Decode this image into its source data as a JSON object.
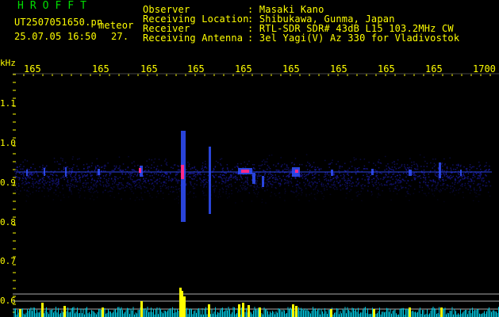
{
  "header": {
    "brand": "HROFFT",
    "filename": "UT2507051650.pn",
    "mode": "meteor",
    "datetime": "25.07.05 16:50",
    "count": "27.",
    "labels": [
      "Observer",
      "Receiving Location",
      "Receiver",
      "Receiving Antenna"
    ],
    "values": [
      ": Masaki Kano",
      ": Shibukawa, Gunma, Japan",
      ": RTL-SDR SDR# 43dB L15 103.2MHz CW",
      ": 3el Yagi(V) Az 330 for Vladivostok"
    ]
  },
  "axes": {
    "y_unit": "kHz",
    "y_ticks": [
      "1.1",
      "1.0",
      "0.9",
      "0.8",
      "0.7",
      "0.6"
    ],
    "x_ticks": [
      "165",
      "165",
      "165",
      "165",
      "165",
      "165",
      "165",
      "165",
      "165",
      "1700"
    ]
  },
  "colors": {
    "text": "#ffff00",
    "brand": "#00dd00",
    "signal_low": "#1a1aa0",
    "signal_high": "#ff2a8a",
    "level": "#ffff00",
    "noise": "#00c8e0"
  }
}
